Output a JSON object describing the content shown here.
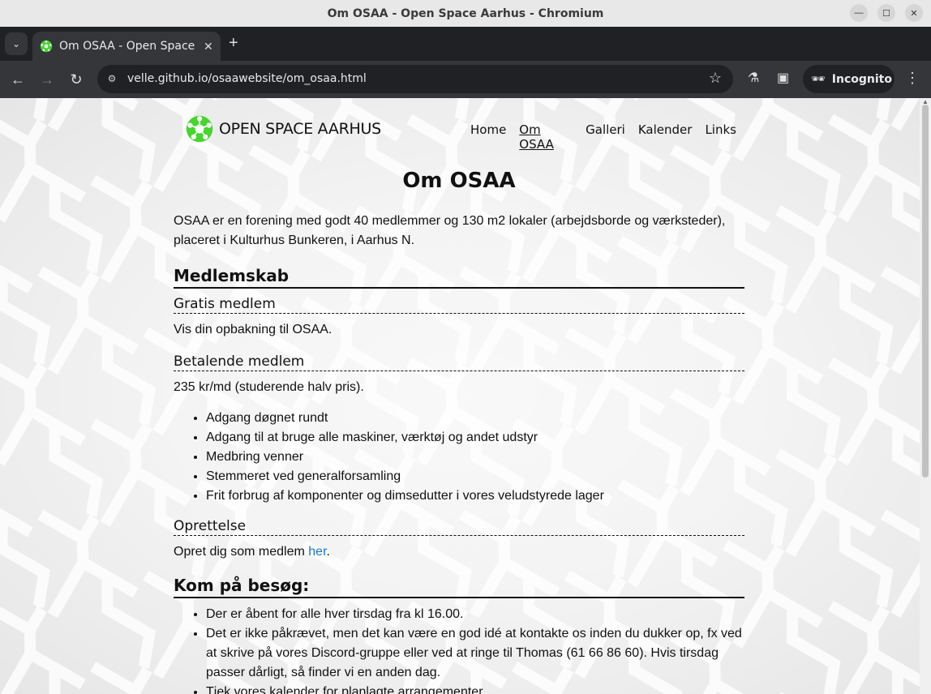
{
  "window": {
    "title": "Om OSAA - Open Space Aarhus - Chromium"
  },
  "tab": {
    "title": "Om OSAA - Open Space Aarhus"
  },
  "omnibox": {
    "url": "velle.github.io/osaawebsite/om_osaa.html"
  },
  "incognito": {
    "label": "Incognito"
  },
  "site": {
    "logo_text": "OPEN SPACE AARHUS",
    "nav": [
      "Home",
      "Om OSAA",
      "Galleri",
      "Kalender",
      "Links"
    ],
    "active_nav": "Om OSAA",
    "brand_color": "#44d62c"
  },
  "page": {
    "title": "Om OSAA",
    "intro": "OSAA er en forening med godt 40 medlemmer og 130 m2 lokaler (arbejdsborde og værksteder), placeret i Kulturhus Bunkeren, i Aarhus N.",
    "membership": {
      "heading": "Medlemskab",
      "free": {
        "heading": "Gratis medlem",
        "text": "Vis din opbakning til OSAA."
      },
      "paid": {
        "heading": "Betalende medlem",
        "text": "235 kr/md (studerende halv pris).",
        "benefits": [
          "Adgang døgnet rundt",
          "Adgang til at bruge alle maskiner, værktøj og andet udstyr",
          "Medbring venner",
          "Stemmeret ved generalforsamling",
          "Frit forbrug af komponenter og dimsedutter i vores veludstyrede lager"
        ]
      },
      "signup": {
        "heading": "Oprettelse",
        "text_before": "Opret dig som medlem ",
        "link": "her",
        "text_after": "."
      }
    },
    "visit": {
      "heading": "Kom på besøg:",
      "items": [
        "Der er åbent for alle hver tirsdag fra kl 16.00.",
        "Det er ikke påkrævet, men det kan være en god idé at kontakte os inden du dukker op, fx ved at skrive på vores Discord-gruppe eller ved at ringe til Thomas (61 66 86 60). Hvis tirsdag passer dårligt, så finder vi en anden dag.",
        "Tjek vores kalender for planlagte arrangementer."
      ]
    }
  }
}
